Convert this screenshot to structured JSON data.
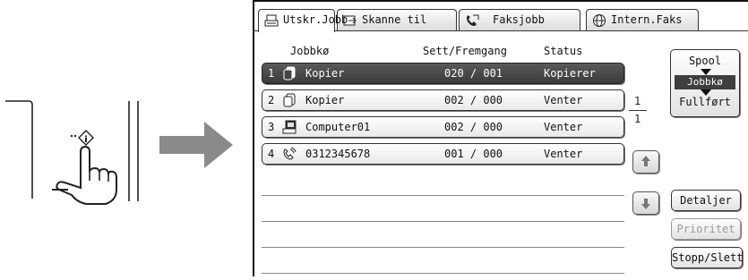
{
  "tabs": [
    {
      "label": "Utskr.Jobb",
      "icon": "printer-icon",
      "active": true
    },
    {
      "label": "Skanne til",
      "icon": "scanner-icon",
      "active": false
    },
    {
      "label": "Faksjobb",
      "icon": "fax-phone-icon",
      "active": false
    },
    {
      "label": "Intern.Faks",
      "icon": "globe-icon",
      "active": false
    }
  ],
  "columns": {
    "queue": "Jobbkø",
    "progress": "Sett/Fremgang",
    "status": "Status"
  },
  "jobs": [
    {
      "num": "1",
      "icon": "copy-icon",
      "name": "Kopier",
      "progress": "020 / 001",
      "status": "Kopierer",
      "selected": true
    },
    {
      "num": "2",
      "icon": "copy-icon",
      "name": "Kopier",
      "progress": "002 / 000",
      "status": "Venter",
      "selected": false
    },
    {
      "num": "3",
      "icon": "computer-icon",
      "name": "Computer01",
      "progress": "002 / 000",
      "status": "Venter",
      "selected": false
    },
    {
      "num": "4",
      "icon": "fax-phone-icon",
      "name": "0312345678",
      "progress": "001 / 000",
      "status": "Venter",
      "selected": false
    }
  ],
  "pagination": {
    "current": "1",
    "total": "1"
  },
  "mode_switch": {
    "top": "Spool",
    "middle": "Jobbkø",
    "bottom": "Fullført"
  },
  "buttons": {
    "details": "Detaljer",
    "priority": "Prioritet",
    "stop_delete": "Stopp/Slett"
  },
  "illustration": {
    "icon": "hand-pointer-icon",
    "arrow": "right-arrow-icon"
  }
}
